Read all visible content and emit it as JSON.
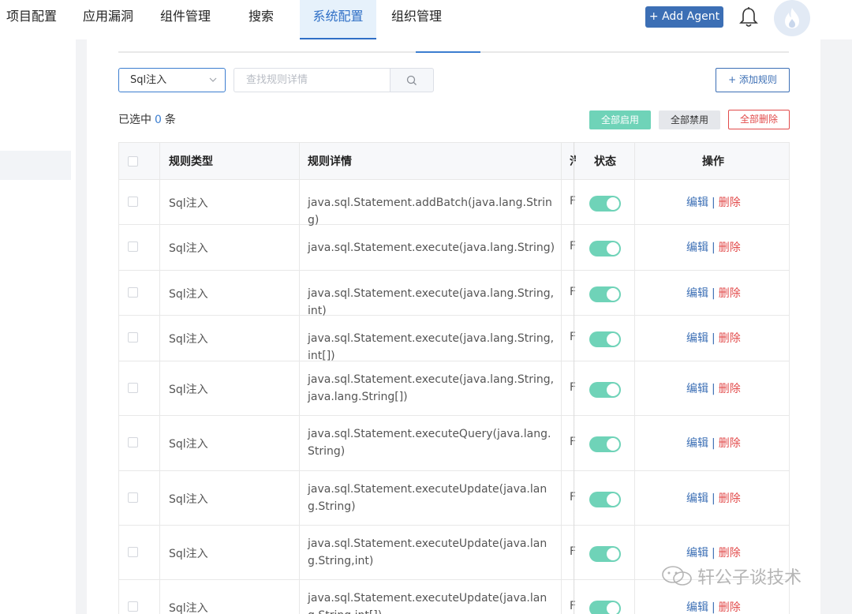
{
  "nav": {
    "items": [
      {
        "label": "项目配置",
        "active": false
      },
      {
        "label": "应用漏洞",
        "active": false
      },
      {
        "label": "组件管理",
        "active": false
      },
      {
        "label": "搜索",
        "active": false
      },
      {
        "label": "系统配置",
        "active": true
      },
      {
        "label": "组织管理",
        "active": false
      }
    ],
    "add_agent": "+ Add Agent",
    "bell_icon": "bell-icon",
    "avatar_icon": "flame-avatar-icon"
  },
  "filters": {
    "type_select": "Sql注入",
    "search_placeholder": "查找规则详情",
    "search_icon": "search-icon",
    "add_rule": "+ 添加规则"
  },
  "selection": {
    "prefix": "已选中",
    "count": "0",
    "suffix": "条"
  },
  "bulk": {
    "enable_all": "全部启用",
    "disable_all": "全部禁用",
    "delete_all": "全部删除"
  },
  "table": {
    "headers": [
      "规则类型",
      "规则详情",
      "汽",
      "状态",
      "操作"
    ],
    "rows": [
      {
        "type": "Sql注入",
        "detail": "java.sql.Statement.addBatch(java.lang.String)",
        "col3": "F",
        "enabled": true
      },
      {
        "type": "Sql注入",
        "detail": "java.sql.Statement.execute(java.lang.String)",
        "col3": "F",
        "enabled": true
      },
      {
        "type": "Sql注入",
        "detail": "java.sql.Statement.execute(java.lang.String,int)",
        "col3": "F",
        "enabled": true
      },
      {
        "type": "Sql注入",
        "detail": "java.sql.Statement.execute(java.lang.String,int[])",
        "col3": "F",
        "enabled": true
      },
      {
        "type": "Sql注入",
        "detail": "java.sql.Statement.execute(java.lang.String,java.lang.String[])",
        "col3": "F",
        "enabled": true
      },
      {
        "type": "Sql注入",
        "detail": "java.sql.Statement.executeQuery(java.lang.String)",
        "col3": "F",
        "enabled": true
      },
      {
        "type": "Sql注入",
        "detail": "java.sql.Statement.executeUpdate(java.lang.String)",
        "col3": "F",
        "enabled": true
      },
      {
        "type": "Sql注入",
        "detail": "java.sql.Statement.executeUpdate(java.lang.String,int)",
        "col3": "F",
        "enabled": true
      },
      {
        "type": "Sql注入",
        "detail": "java.sql.Statement.executeUpdate(java.lang.String,int[])",
        "col3": "F",
        "enabled": true
      }
    ],
    "edit_label": "编辑",
    "separator": "|",
    "delete_label": "删除"
  },
  "watermark": "轩公子谈技术",
  "colors": {
    "primary": "#3c6fb5",
    "link_blue": "#3c7ed0",
    "toggle_on": "#6fd3b8",
    "danger": "#e24b4b"
  }
}
